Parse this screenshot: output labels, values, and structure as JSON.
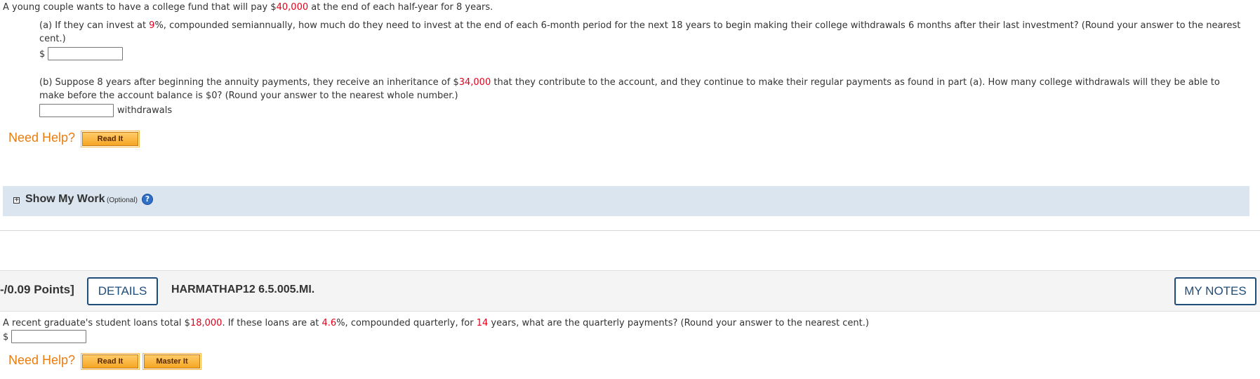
{
  "q1": {
    "intro_pre": "A young couple wants to have a college fund that will pay $",
    "intro_amount": "40,000",
    "intro_post": " at the end of each half-year for 8 years.",
    "a_pre": "(a) If they can invest at ",
    "a_rate": "9",
    "a_post": "%, compounded semiannually, how much do they need to invest at the end of each 6-month period for the next 18 years to begin making their college withdrawals 6 months after their last investment? (Round your answer to the nearest",
    "a_line2": "cent.)",
    "a_currency": "$",
    "a_value": "",
    "b_pre": "(b) Suppose 8 years after beginning the annuity payments, they receive an inheritance of $",
    "b_amount": "34,000",
    "b_post": " that they contribute to the account, and they continue to make their regular payments as found in part (a). How many college withdrawals will they be able to",
    "b_line2": "make before the account balance is $0? (Round your answer to the nearest whole number.)",
    "b_value": "",
    "b_unit": "withdrawals",
    "need_help": "Need Help?",
    "read_it": "Read It",
    "show_my_work": "Show My Work",
    "optional": "(Optional)"
  },
  "q2_header": {
    "points": "-/0.09 Points]",
    "details": "DETAILS",
    "code": "HARMATHAP12 6.5.005.MI.",
    "my_notes": "MY NOTES"
  },
  "q2": {
    "text_pre": "A recent graduate's student loans total $",
    "amount": "18,000",
    "text_mid1": ". If these loans are at ",
    "rate": "4.6",
    "text_mid2": "%, compounded quarterly, for ",
    "years": "14",
    "text_post": " years, what are the quarterly payments? (Round your answer to the nearest cent.)",
    "currency": "$",
    "value": "",
    "need_help": "Need Help?",
    "read_it": "Read It",
    "master_it": "Master It"
  }
}
